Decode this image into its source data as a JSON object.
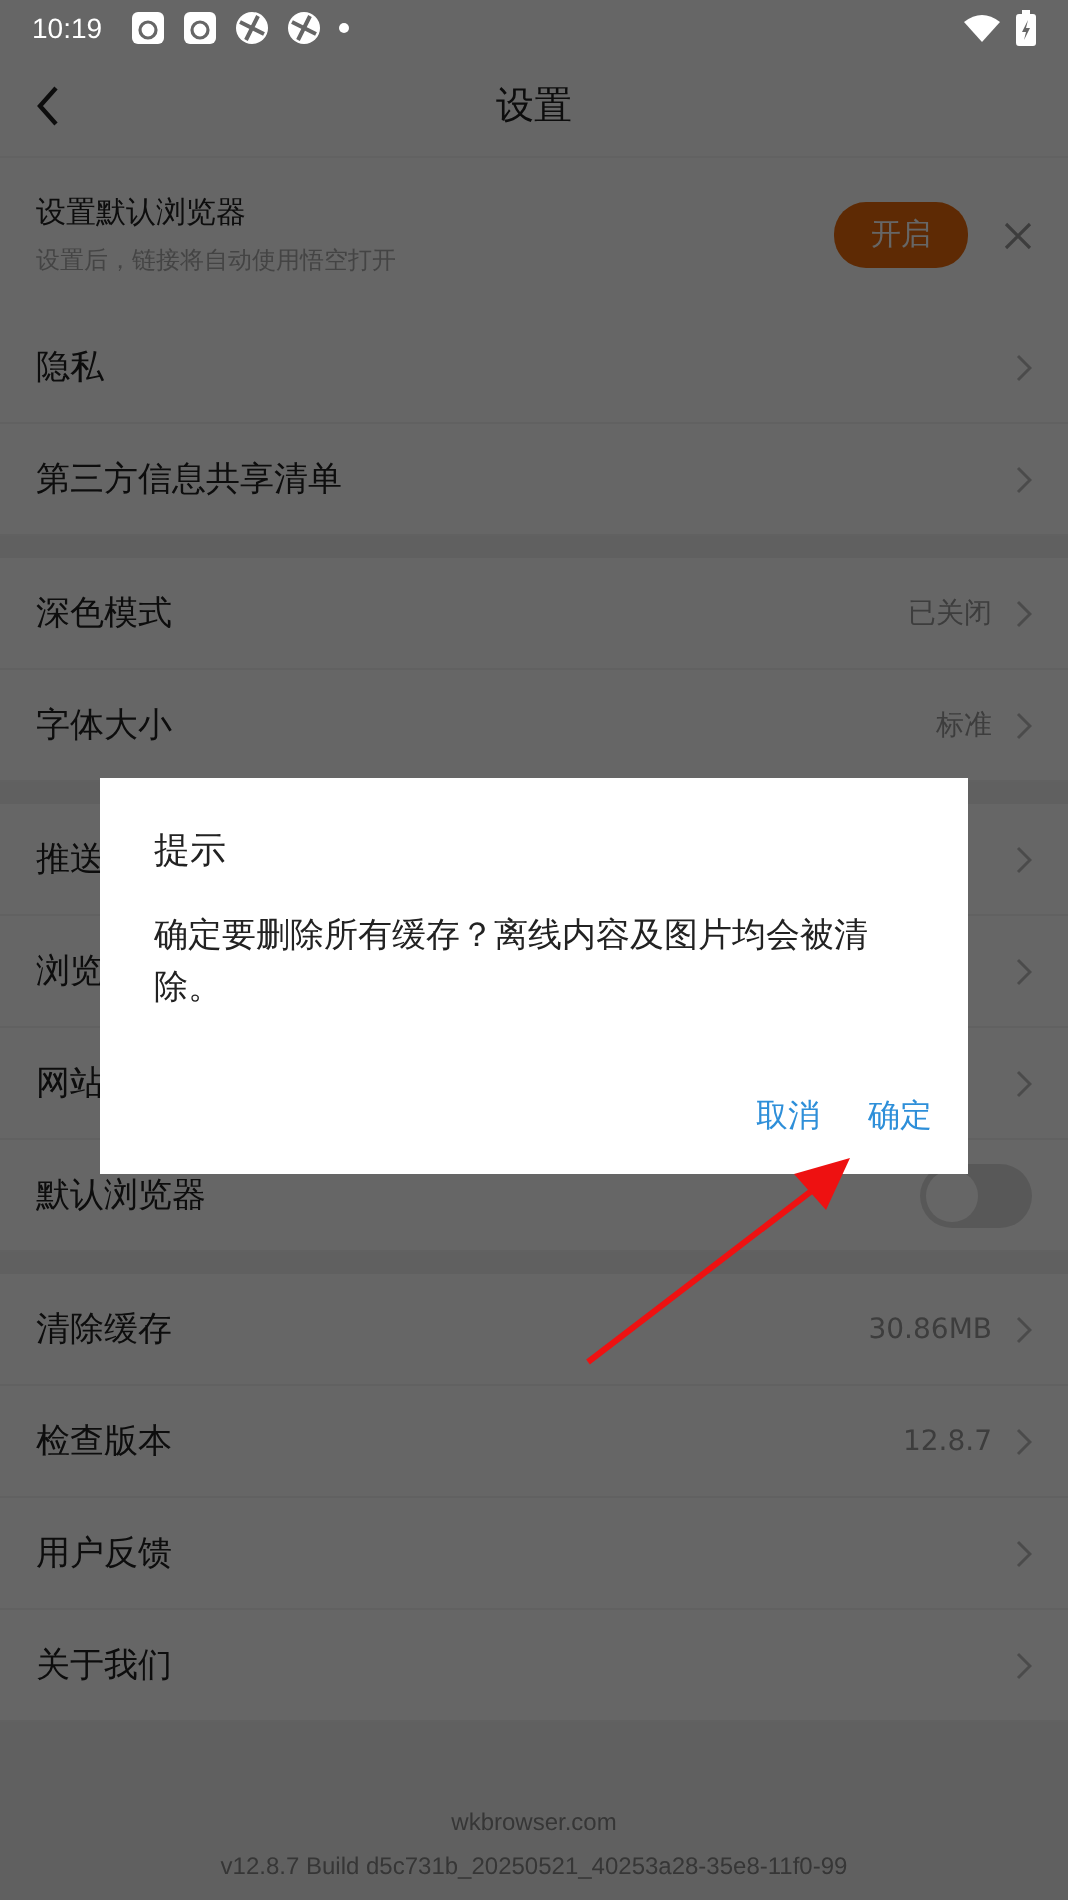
{
  "status_bar": {
    "time": "10:19"
  },
  "header": {
    "title": "设置"
  },
  "banner": {
    "title": "设置默认浏览器",
    "subtitle": "设置后，链接将自动使用悟空打开",
    "button": "开启"
  },
  "sections": [
    [
      {
        "kind": "link",
        "label": "隐私"
      },
      {
        "kind": "link",
        "label": "第三方信息共享清单"
      }
    ],
    [
      {
        "kind": "link",
        "label": "深色模式",
        "value": "已关闭"
      },
      {
        "kind": "link",
        "label": "字体大小",
        "value": "标准"
      }
    ],
    [
      {
        "kind": "link",
        "label": "推送"
      },
      {
        "kind": "link",
        "label": "浏览"
      },
      {
        "kind": "link",
        "label": "网站"
      },
      {
        "kind": "toggle",
        "label": "默认浏览器",
        "on": false
      }
    ],
    [
      {
        "kind": "link",
        "label": "清除缓存",
        "value": "30.86MB"
      },
      {
        "kind": "link",
        "label": "检查版本",
        "value": "12.8.7"
      },
      {
        "kind": "link",
        "label": "用户反馈"
      },
      {
        "kind": "link",
        "label": "关于我们"
      }
    ]
  ],
  "footer": {
    "site": "wkbrowser.com",
    "build": "v12.8.7 Build d5c731b_20250521_40253a28-35e8-11f0-99"
  },
  "dialog": {
    "title": "提示",
    "message": "确定要删除所有缓存？离线内容及图片均会被清除。",
    "buttons": [
      "取消",
      "确定"
    ]
  }
}
